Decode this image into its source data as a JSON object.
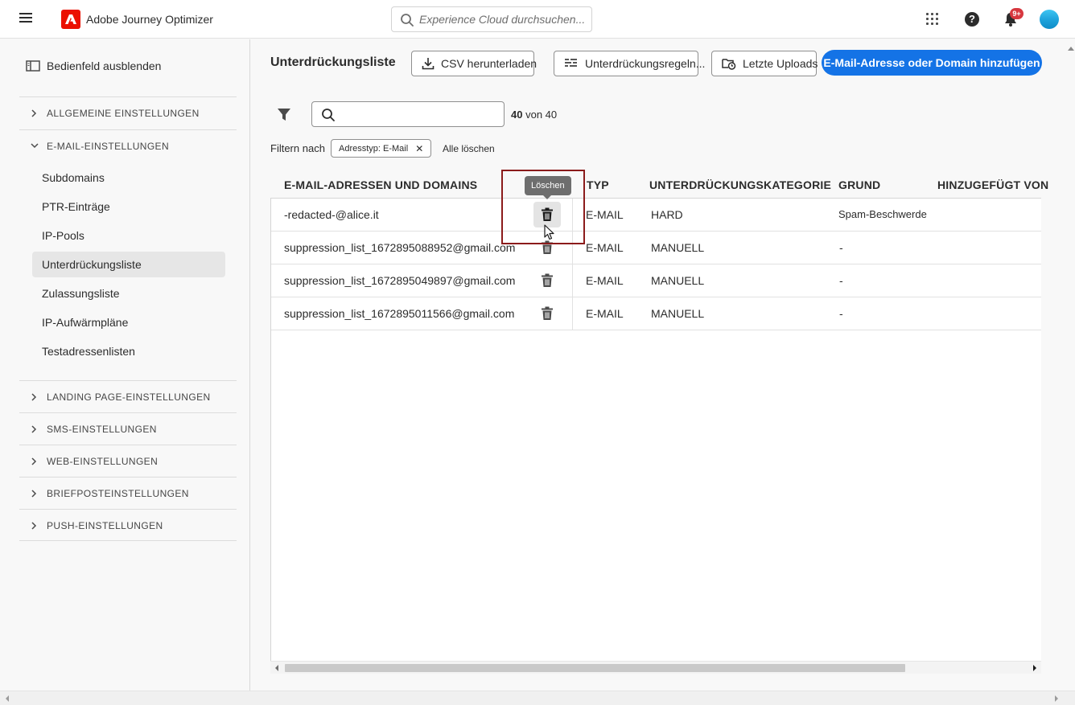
{
  "header": {
    "menu_icon": "hamburger-icon",
    "logo_icon": "adobe-logo",
    "app_title": "Adobe Journey Optimizer",
    "search_placeholder": "Experience Cloud durchsuchen...",
    "notifications_badge": "9+",
    "icons": [
      "apps-grid-icon",
      "help-icon",
      "bell-icon",
      "avatar"
    ]
  },
  "sidebar": {
    "hide_panel_label": "Bedienfeld ausblenden",
    "sections": [
      {
        "label": "ALLGEMEINE EINSTELLUNGEN",
        "expanded": false
      },
      {
        "label": "E-MAIL-EINSTELLUNGEN",
        "expanded": true
      },
      {
        "label": "LANDING PAGE-EINSTELLUNGEN",
        "expanded": false
      },
      {
        "label": "SMS-EINSTELLUNGEN",
        "expanded": false
      },
      {
        "label": "WEB-EINSTELLUNGEN",
        "expanded": false
      },
      {
        "label": "BRIEFPOSTEINSTELLUNGEN",
        "expanded": false
      },
      {
        "label": "PUSH-EINSTELLUNGEN",
        "expanded": false
      }
    ],
    "email_items": [
      "Subdomains",
      "PTR-Einträge",
      "IP-Pools",
      "Unterdrückungsliste",
      "Zulassungsliste",
      "IP-Aufwärmpläne",
      "Testadressenlisten"
    ],
    "active_item": "Unterdrückungsliste"
  },
  "main": {
    "title": "Unterdrückungsliste",
    "buttons": {
      "download_csv": "CSV herunterladen",
      "suppression_rules": "Unterdrückungsregeln...",
      "recent_uploads": "Letzte Uploads",
      "add": "E-Mail-Adresse oder Domain hinzufügen"
    },
    "count_current": "40",
    "count_text": "von 40",
    "filter_by_label": "Filtern nach",
    "filter_tag": "Adresstyp: E-Mail",
    "clear_all": "Alle löschen",
    "columns": [
      "E-MAIL-ADRESSEN UND DOMAINS",
      "TYP",
      "UNTERDRÜCKUNGSKATEGORIE",
      "GRUND",
      "HINZUGEFÜGT VON"
    ],
    "rows": [
      {
        "address": "-redacted-@alice.it",
        "type": "E-MAIL",
        "category": "HARD",
        "reason": "Spam-Beschwerde"
      },
      {
        "address": "suppression_list_1672895088952@gmail.com",
        "type": "E-MAIL",
        "category": "MANUELL",
        "reason": "-"
      },
      {
        "address": "suppression_list_1672895049897@gmail.com",
        "type": "E-MAIL",
        "category": "MANUELL",
        "reason": "-"
      },
      {
        "address": "suppression_list_1672895011566@gmail.com",
        "type": "E-MAIL",
        "category": "MANUELL",
        "reason": "-"
      }
    ],
    "tooltip": "Löschen"
  },
  "colors": {
    "accent": "#1473e6",
    "brand": "#eb1000",
    "highlight_border": "#8b1b1b",
    "badge": "#d7373f"
  }
}
